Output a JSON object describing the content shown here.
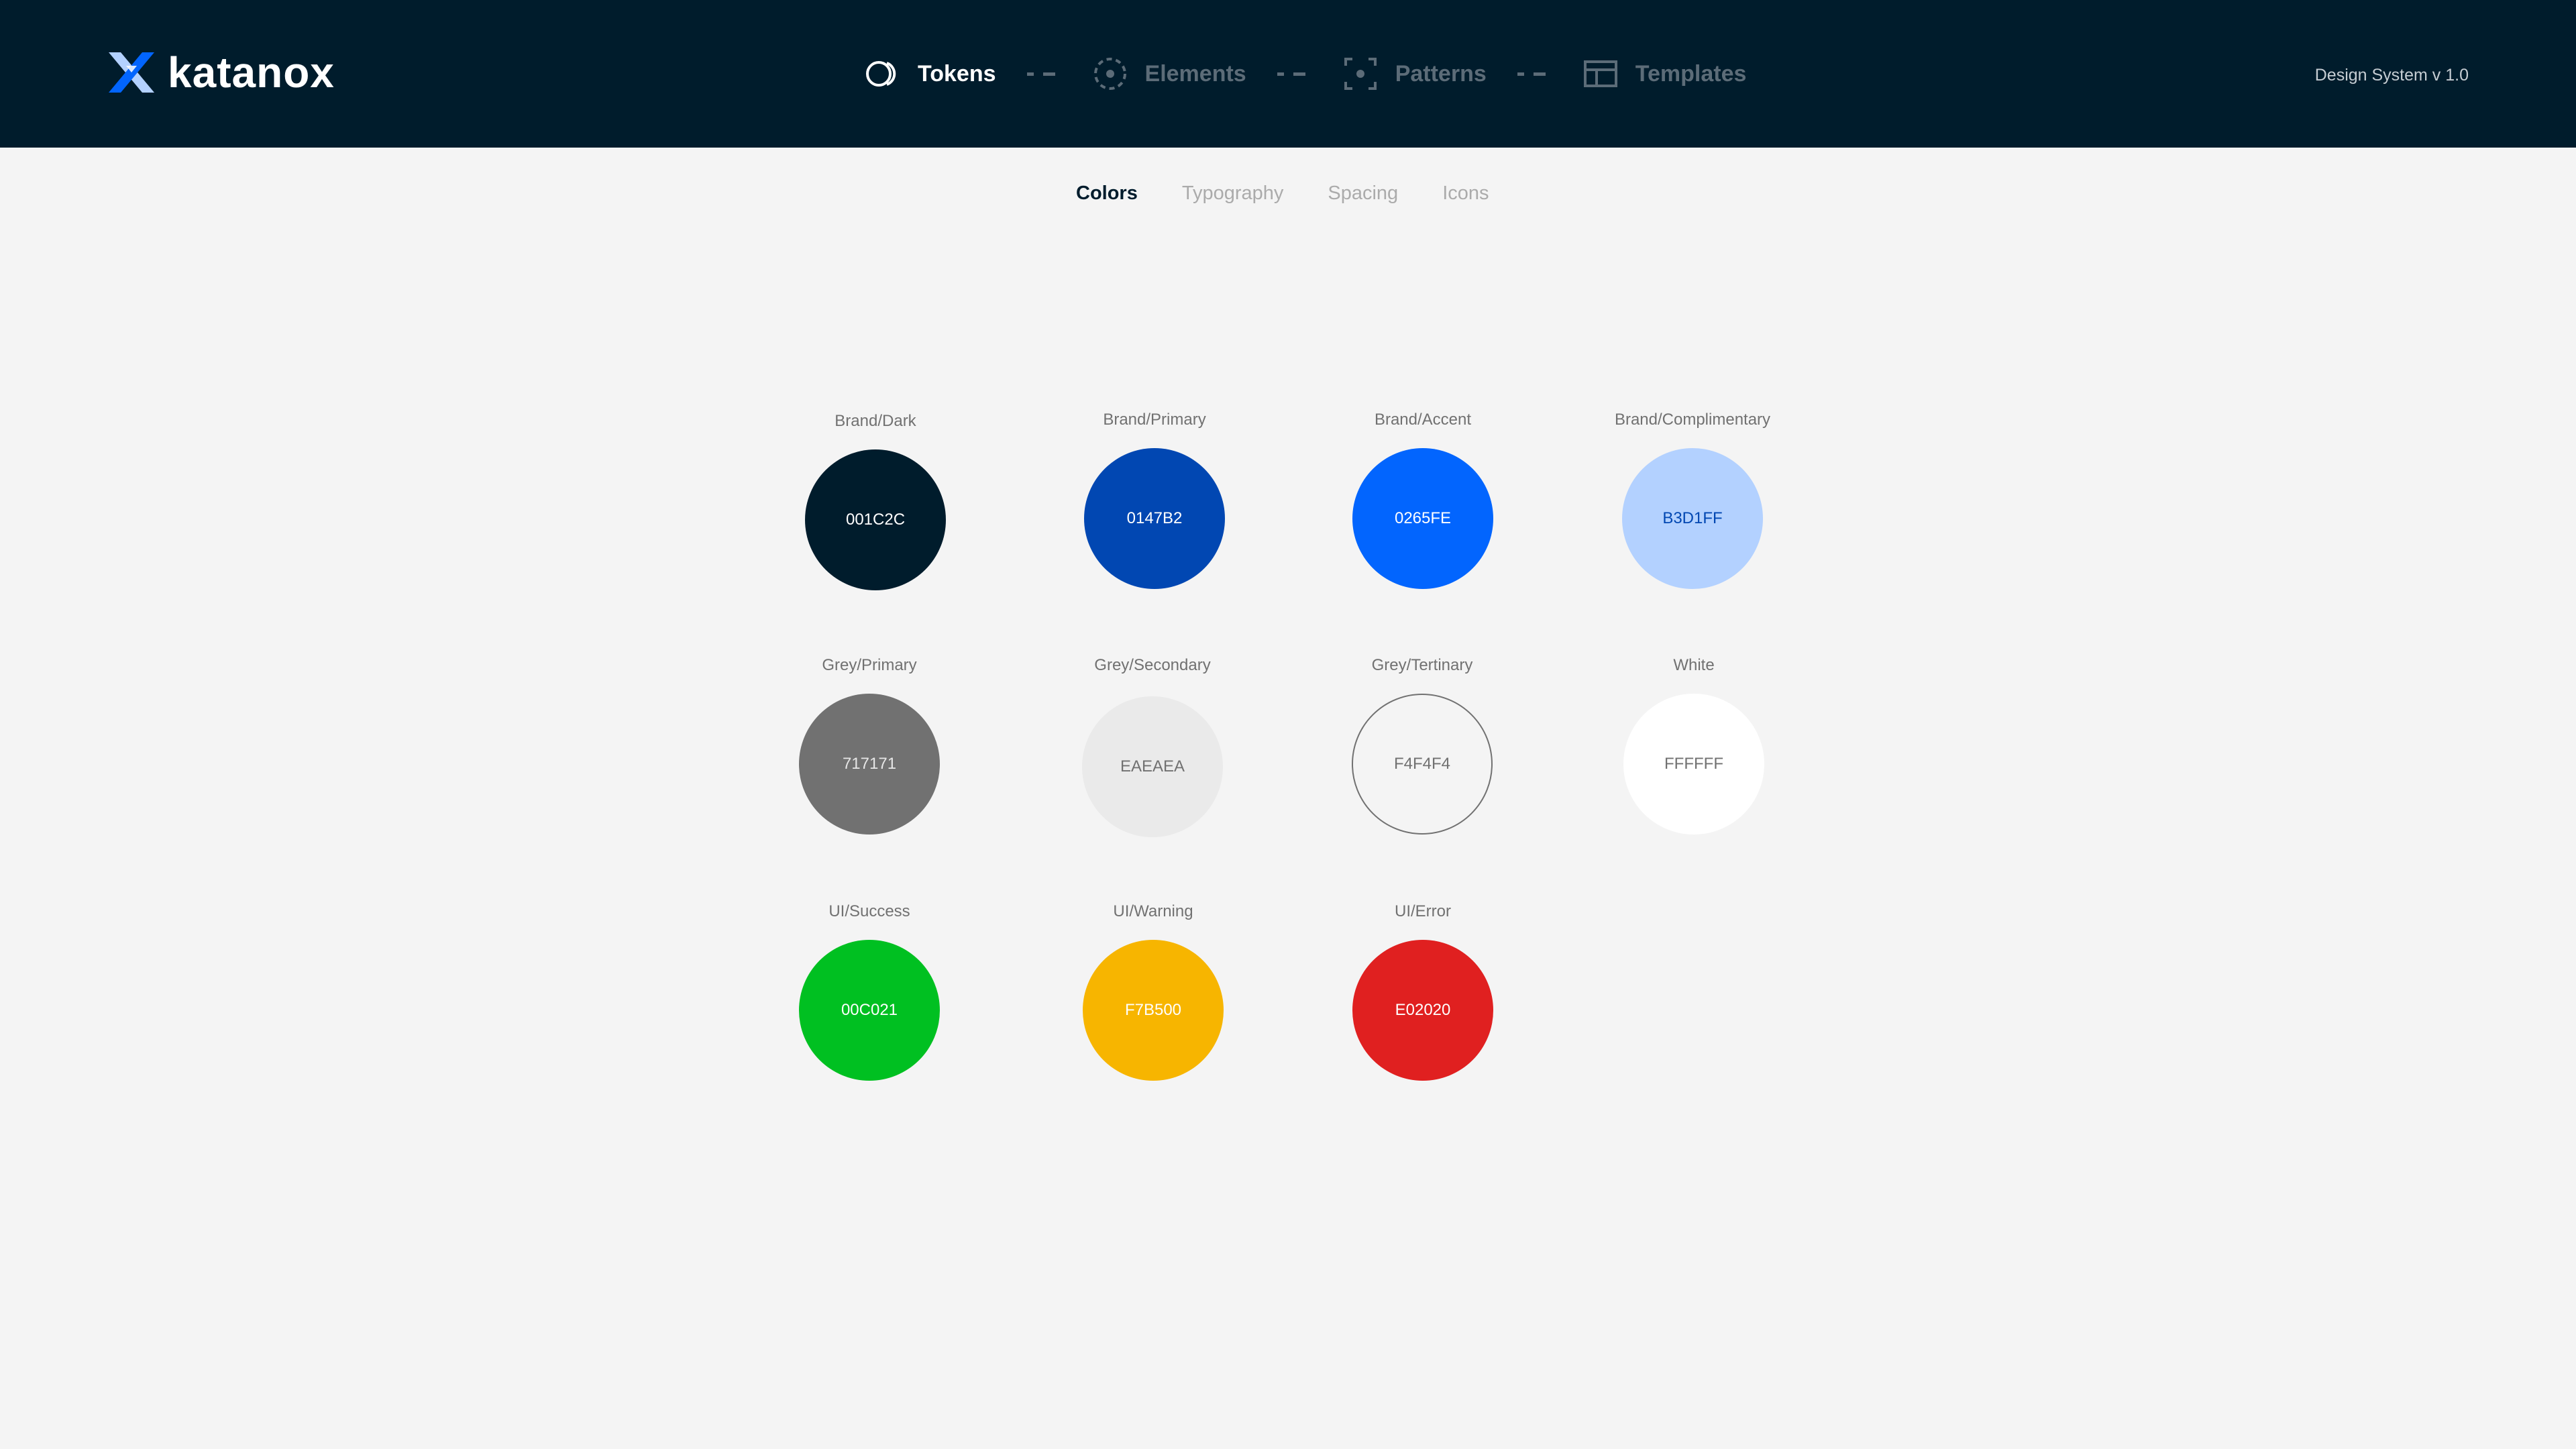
{
  "header": {
    "logo_text": "katanox",
    "version": "Design System v 1.0",
    "nav": [
      {
        "label": "Tokens",
        "icon": "tokens-icon",
        "active": true
      },
      {
        "label": "Elements",
        "icon": "elements-icon",
        "active": false
      },
      {
        "label": "Patterns",
        "icon": "patterns-icon",
        "active": false
      },
      {
        "label": "Templates",
        "icon": "templates-icon",
        "active": false
      }
    ]
  },
  "subtabs": [
    {
      "label": "Colors",
      "active": true
    },
    {
      "label": "Typography",
      "active": false
    },
    {
      "label": "Spacing",
      "active": false
    },
    {
      "label": "Icons",
      "active": false
    }
  ],
  "colors": [
    {
      "name": "Brand/Dark",
      "code": "001C2C",
      "fill": "#001C2C",
      "text_color": "#FFFFFF",
      "border": "none"
    },
    {
      "name": "Brand/Primary",
      "code": "0147B2",
      "fill": "#0147B2",
      "text_color": "#FFFFFF",
      "border": "none"
    },
    {
      "name": "Brand/Accent",
      "code": "0265FE",
      "fill": "#0265FE",
      "text_color": "#FFFFFF",
      "border": "none"
    },
    {
      "name": "Brand/Complimentary",
      "code": "B3D1FF",
      "fill": "#B3D1FF",
      "text_color": "#0147B2",
      "border": "none"
    },
    {
      "name": "Grey/Primary",
      "code": "717171",
      "fill": "#717171",
      "text_color": "#E6E6E6",
      "border": "none"
    },
    {
      "name": "Grey/Secondary",
      "code": "EAEAEA",
      "fill": "#EAEAEA",
      "text_color": "#717171",
      "border": "none"
    },
    {
      "name": "Grey/Tertinary",
      "code": "F4F4F4",
      "fill": "#F4F4F4",
      "text_color": "#717171",
      "border": "#717171"
    },
    {
      "name": "White",
      "code": "FFFFFF",
      "fill": "#FFFFFF",
      "text_color": "#717171",
      "border": "none"
    },
    {
      "name": "UI/Success",
      "code": "00C021",
      "fill": "#00C021",
      "text_color": "#FFFFFF",
      "border": "none"
    },
    {
      "name": "UI/Warning",
      "code": "F7B500",
      "fill": "#F7B500",
      "text_color": "#FFFFFF",
      "border": "none"
    },
    {
      "name": "UI/Error",
      "code": "E02020",
      "fill": "#E02020",
      "text_color": "#FFFFFF",
      "border": "none"
    }
  ]
}
